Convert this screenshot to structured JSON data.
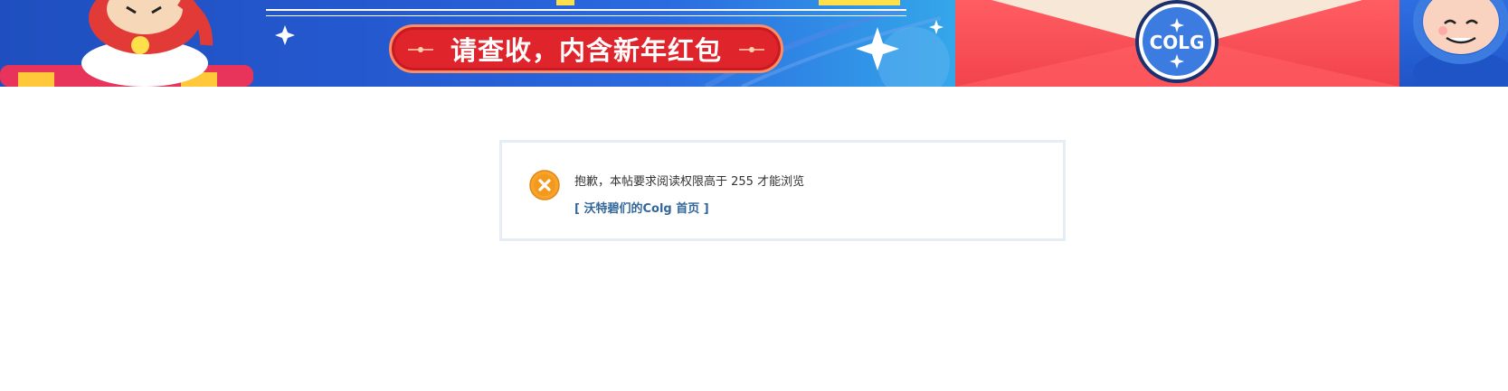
{
  "banner": {
    "slogan": "请查收，内含新年红包",
    "seal_text": "COLG",
    "colors": {
      "blue": "#2559d0",
      "red": "#f2434c",
      "pill": "#e0242c"
    }
  },
  "message": {
    "icon": "error-x-icon",
    "text": "抱歉，本帖要求阅读权限高于 255 才能浏览",
    "link_label": "[ 沃特碧们的Colg 首页 ]",
    "icon_color": "#f39a1e",
    "border_color": "#e5eef7",
    "link_color": "#336699"
  }
}
